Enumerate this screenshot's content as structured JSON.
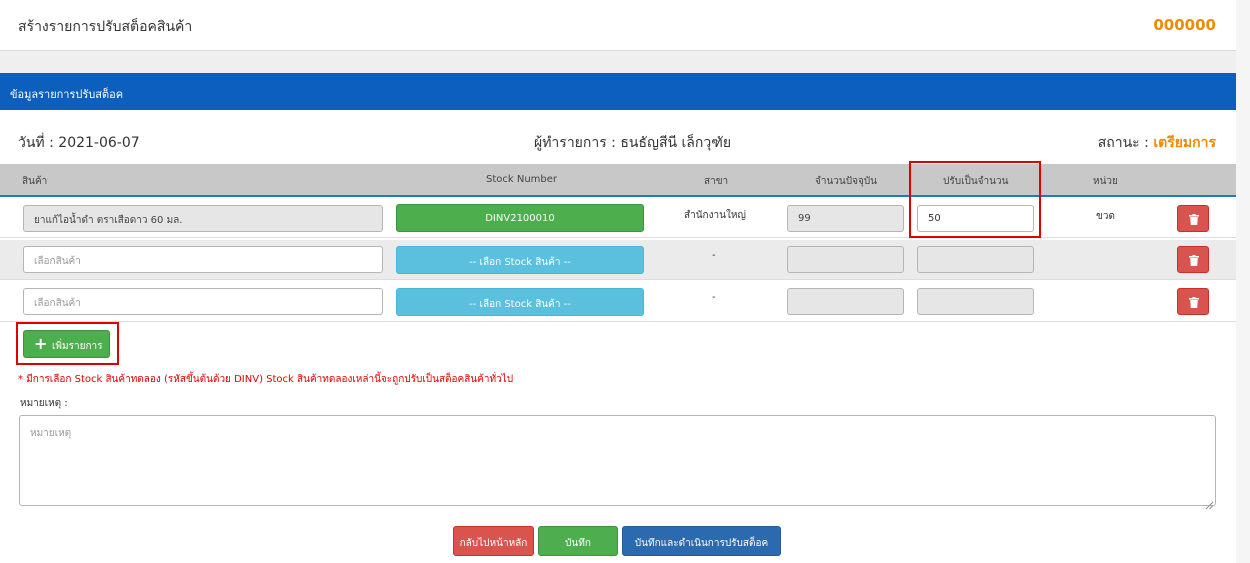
{
  "header": {
    "title": "สร้างรายการปรับสต็อคสินค้า",
    "doc_number": "000000"
  },
  "panel": {
    "title": "ข้อมูลรายการปรับสต็อค"
  },
  "info": {
    "date_label": "วันที่ :",
    "date_value": "2021-06-07",
    "maker_label": "ผู้ทำรายการ :",
    "maker_value": "ธนธัญสีนี เล็กวุฑัย",
    "status_label": "สถานะ :",
    "status_value": "เตรียมการ"
  },
  "table": {
    "headers": {
      "product": "สินค้า",
      "stock_number": "Stock Number",
      "branch": "สาขา",
      "current_qty": "จำนวนปัจจุบัน",
      "adjust_to": "ปรับเป็นจำนวน",
      "unit": "หน่วย"
    },
    "rows": [
      {
        "product": "ยาแก้ไอน้ำดำ ตราเสือดาว 60 มล.",
        "stock": "DINV2100010",
        "branch": "สำนักงานใหญ่",
        "current_qty": "99",
        "adjust_to": "50",
        "unit": "ขวด"
      },
      {
        "product_placeholder": "เลือกสินค้า",
        "stock": "-- เลือก Stock สินค้า --",
        "branch": "-"
      },
      {
        "product_placeholder": "เลือกสินค้า",
        "stock": "-- เลือก Stock สินค้า --",
        "branch": "-"
      }
    ]
  },
  "add_button": "เพิ่มรายการ",
  "note": "* มีการเลือก Stock สินค้าทดลอง (รหัสขึ้นต้นด้วย DINV) Stock สินค้าทดลองเหล่านี้จะถูกปรับเป็นสต็อคสินค้าทั่วไป",
  "remark": {
    "label": "หมายเหตุ :",
    "placeholder": "หมายเหตุ"
  },
  "footer": {
    "back": "กลับไปหน้าหลัก",
    "save": "บันทึก",
    "save_and_run": "บันทึกและดำเนินการปรับสต็อค"
  },
  "colors": {
    "header_blue": "#0d5fbd",
    "accent_orange": "#f08a00",
    "success": "#4cae4c",
    "info": "#5bc0de",
    "danger": "#d9534f",
    "highlight": "#e00000"
  }
}
